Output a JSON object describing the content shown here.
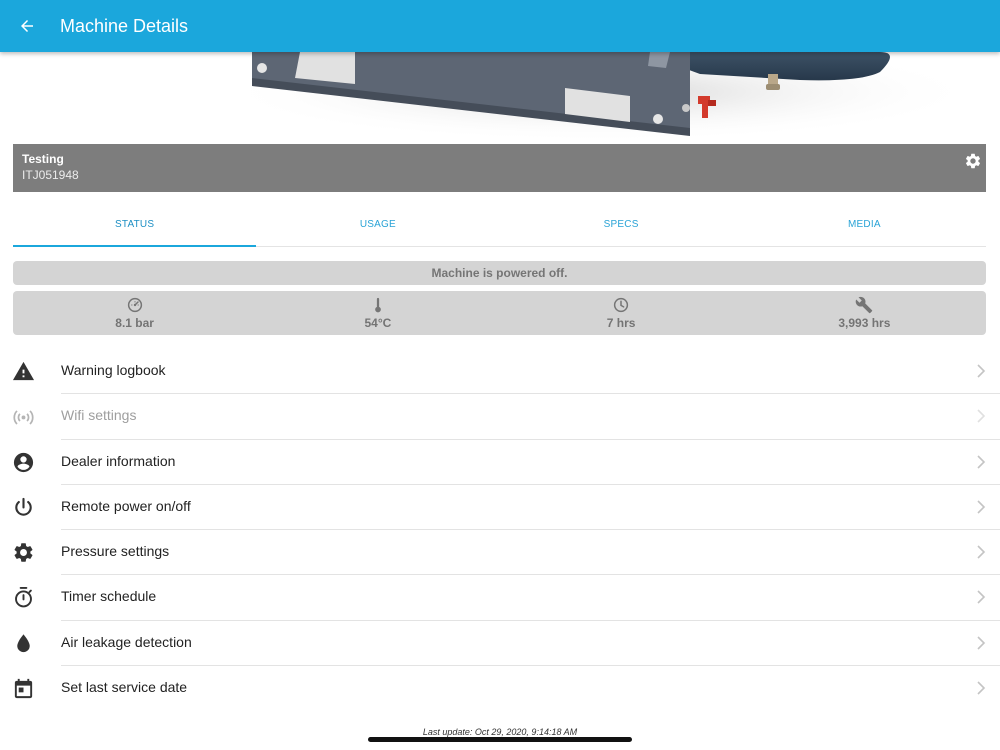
{
  "appbar": {
    "title": "Machine Details",
    "back_icon": "arrow-back-icon",
    "background": "#1ba7dc"
  },
  "machine": {
    "name": "Testing",
    "serial": "ITJ051948",
    "settings_icon": "gear-icon"
  },
  "tabs": [
    {
      "label": "STATUS",
      "active": true
    },
    {
      "label": "USAGE",
      "active": false
    },
    {
      "label": "SPECS",
      "active": false
    },
    {
      "label": "MEDIA",
      "active": false
    }
  ],
  "status": {
    "message": "Machine is powered off."
  },
  "metrics": [
    {
      "icon": "speedometer-icon",
      "value": "8.1 bar"
    },
    {
      "icon": "thermometer-icon",
      "value": "54°C"
    },
    {
      "icon": "clock-icon",
      "value": "7 hrs"
    },
    {
      "icon": "wrench-icon",
      "value": "3,993 hrs"
    }
  ],
  "menu": [
    {
      "icon": "warning-icon",
      "label": "Warning logbook",
      "enabled": true
    },
    {
      "icon": "wifi-icon",
      "label": "Wifi settings",
      "enabled": false
    },
    {
      "icon": "account-icon",
      "label": "Dealer information",
      "enabled": true
    },
    {
      "icon": "power-icon",
      "label": "Remote power on/off",
      "enabled": true
    },
    {
      "icon": "gear-icon",
      "label": "Pressure settings",
      "enabled": true
    },
    {
      "icon": "timer-icon",
      "label": "Timer schedule",
      "enabled": true
    },
    {
      "icon": "drop-icon",
      "label": "Air leakage detection",
      "enabled": true
    },
    {
      "icon": "calendar-icon",
      "label": "Set last service date",
      "enabled": true
    }
  ],
  "footer": {
    "last_update": "Last update: Oct 29, 2020, 9:14:18 AM"
  }
}
